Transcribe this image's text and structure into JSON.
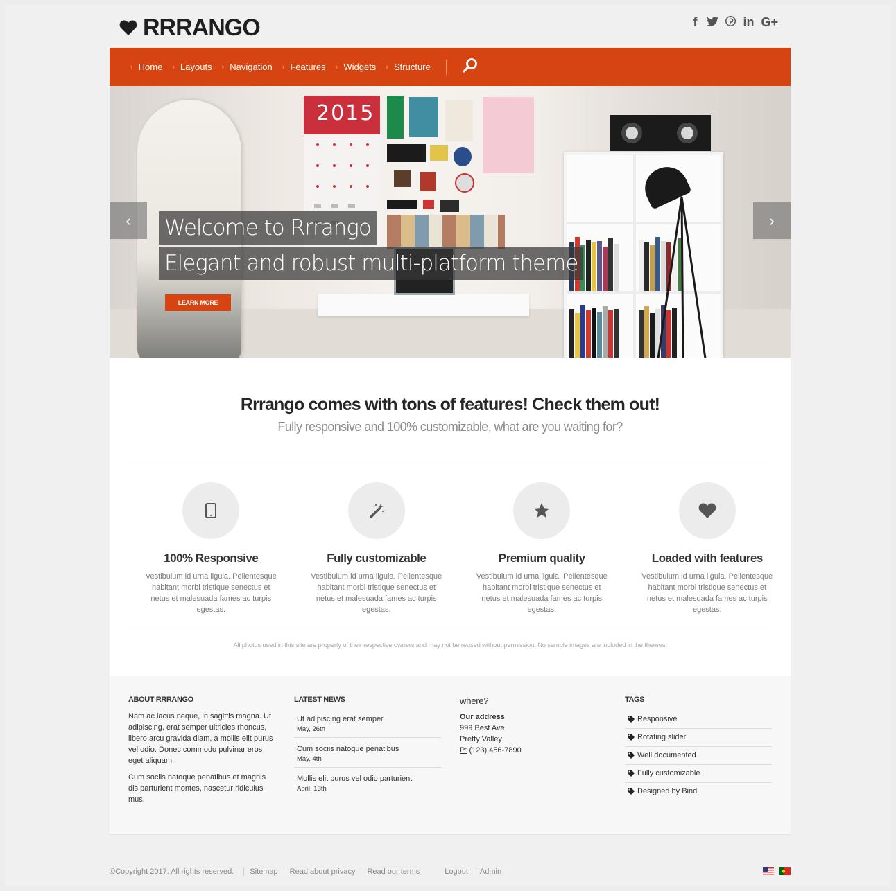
{
  "brand": {
    "name": "RRRANGO"
  },
  "social": [
    "f",
    "t",
    "p",
    "in",
    "G+"
  ],
  "nav": {
    "items": [
      {
        "label": "Home"
      },
      {
        "label": "Layouts"
      },
      {
        "label": "Navigation"
      },
      {
        "label": "Features"
      },
      {
        "label": "Widgets"
      },
      {
        "label": "Structure"
      }
    ]
  },
  "slider": {
    "caption_1": "Welcome to Rrrango",
    "caption_2": "Elegant and robust multi-platform theme",
    "button": "LEARN MORE",
    "poster_year": "2015",
    "prev": "‹",
    "next": "›"
  },
  "features": {
    "title": "Rrrango comes with tons of features! Check them out!",
    "subtitle": "Fully responsive and 100% customizable, what are you waiting for?",
    "items": [
      {
        "icon": "tablet-icon",
        "title": "100% Responsive",
        "text": "Vestibulum id urna ligula. Pellentesque habitant morbi tristique senectus et netus et malesuada fames ac turpis egestas."
      },
      {
        "icon": "magic-wand-icon",
        "title": "Fully customizable",
        "text": "Vestibulum id urna ligula. Pellentesque habitant morbi tristique senectus et netus et malesuada fames ac turpis egestas."
      },
      {
        "icon": "star-icon",
        "title": "Premium quality",
        "text": "Vestibulum id urna ligula. Pellentesque habitant morbi tristique senectus et netus et malesuada fames ac turpis egestas."
      },
      {
        "icon": "heart-icon",
        "title": "Loaded with features",
        "text": "Vestibulum id urna ligula. Pellentesque habitant morbi tristique senectus et netus et malesuada fames ac turpis egestas."
      }
    ],
    "note": "All photos used in this site are property of their respective owners and may not be reused without permission. No sample images are included in the themes."
  },
  "footer": {
    "about": {
      "title": "ABOUT RRRANGO",
      "p1": "Nam ac lacus neque, in sagittis magna. Ut adipiscing, erat semper ultricies rhoncus, libero arcu gravida diam, a mollis elit purus vel odio. Donec commodo pulvinar eros eget aliquam.",
      "p2": "Cum sociis natoque penatibus et magnis dis parturient montes, nascetur ridiculus mus."
    },
    "news": {
      "title": "LATEST NEWS",
      "items": [
        {
          "title": "Ut adipiscing erat semper",
          "date": "May, 26th"
        },
        {
          "title": "Cum sociis natoque penatibus",
          "date": "May, 4th"
        },
        {
          "title": "Mollis elit purus vel odio parturient",
          "date": "April, 13th"
        }
      ]
    },
    "where": {
      "title": "where?",
      "label": "Our address",
      "street": "999 Best Ave",
      "city": "Pretty Valley",
      "phone_prefix": "P:",
      "phone": " (123) 456-7890"
    },
    "tags": {
      "title": "TAGS",
      "items": [
        "Responsive",
        "Rotating slider",
        "Well documented",
        "Fully customizable",
        "Designed by Bind"
      ]
    }
  },
  "bottom": {
    "copyright": "©Copyright 2017. All rights reserved.",
    "links": [
      "Sitemap",
      "Read about privacy",
      "Read our terms"
    ],
    "links2": [
      "Logout",
      "Admin"
    ]
  },
  "colors": {
    "accent": "#d64412",
    "background": "#ededed"
  }
}
